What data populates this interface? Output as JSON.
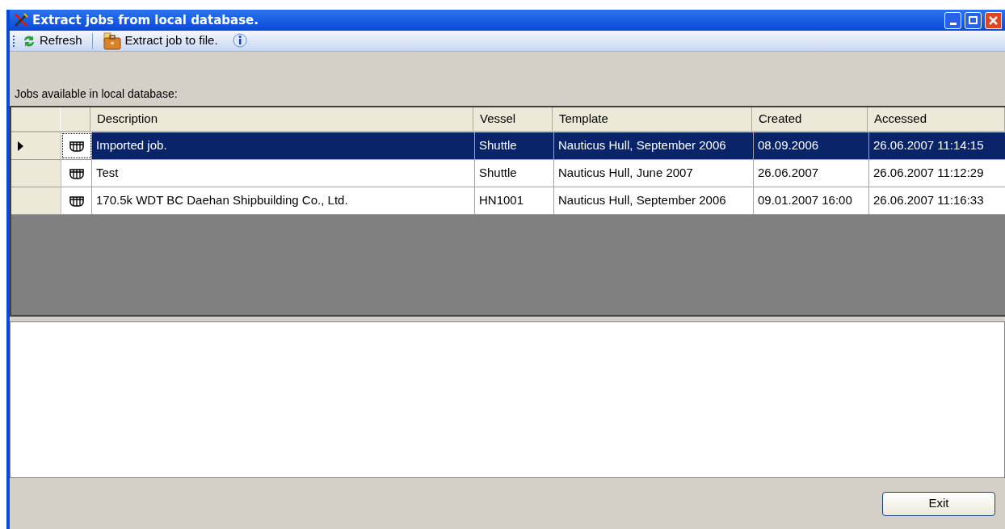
{
  "window": {
    "title": "Extract jobs from local database."
  },
  "toolbar": [
    {
      "kind": "refresh",
      "label": "Refresh"
    },
    {
      "kind": "extract",
      "label": "Extract job to file."
    },
    {
      "kind": "info"
    }
  ],
  "grid_label": "Jobs available in local database:",
  "table": {
    "columns": [
      "Description",
      "Vessel",
      "Template",
      "Created",
      "Accessed"
    ],
    "rows": [
      {
        "selected": true,
        "cells": [
          "Imported job.",
          "Shuttle",
          "Nauticus Hull, September 2006",
          "08.09.2006",
          "26.06.2007 11:14:15"
        ]
      },
      {
        "selected": false,
        "cells": [
          "Test",
          "Shuttle",
          "Nauticus Hull, June 2007",
          "26.06.2007",
          "26.06.2007 11:12:29"
        ]
      },
      {
        "selected": false,
        "cells": [
          "170.5k WDT BC Daehan Shipbuilding Co., Ltd.",
          "HN1001",
          "Nauticus Hull, September 2006",
          "09.01.2007 16:00",
          "26.06.2007 11:16:33"
        ]
      }
    ]
  },
  "buttons": [
    "Exit"
  ]
}
